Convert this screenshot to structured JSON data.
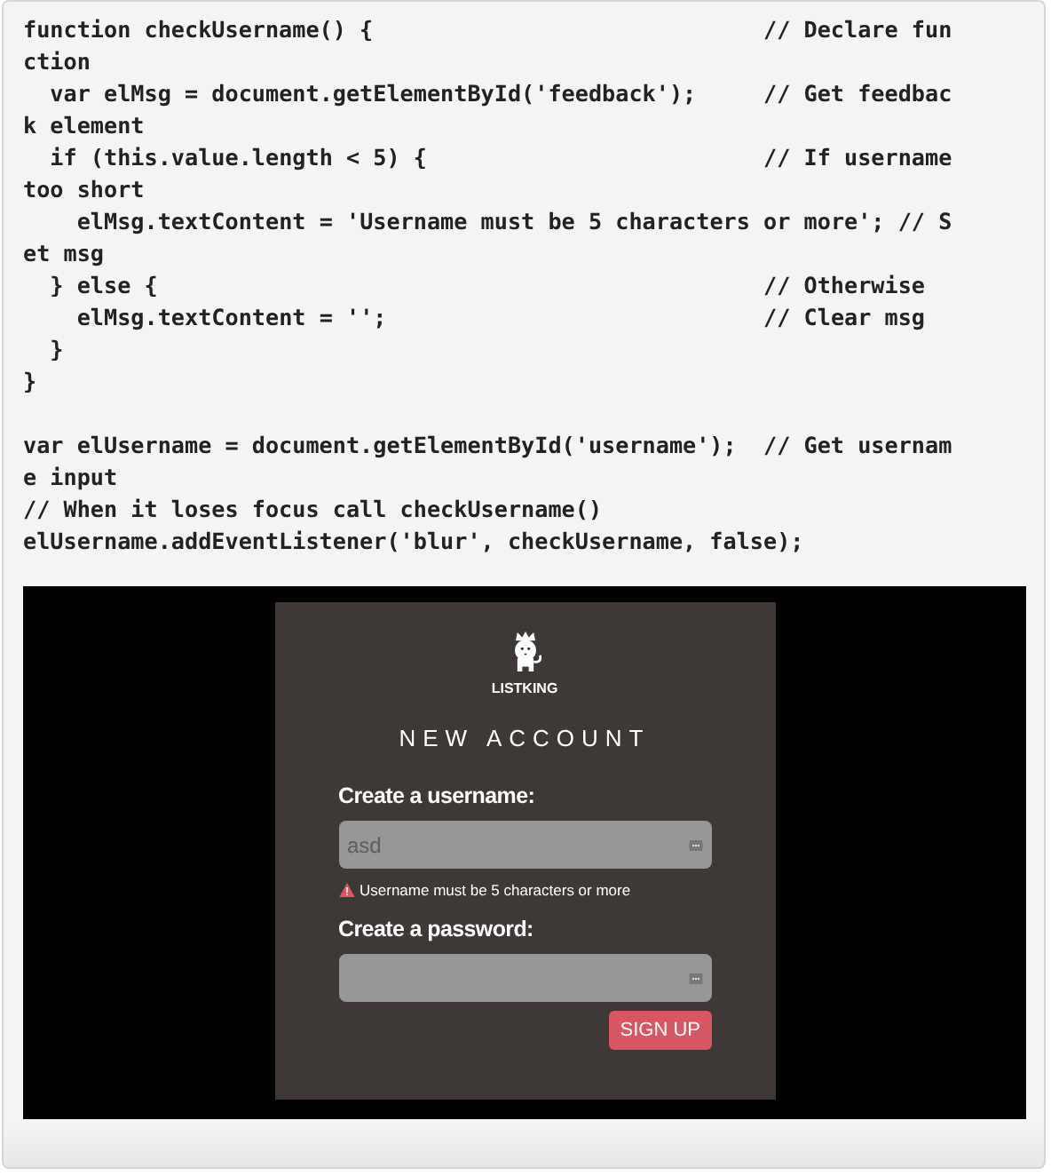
{
  "code_blocks": [
    [
      "function checkUsername() {                             // Declare function",
      "  var elMsg = document.getElementById('feedback');     // Get feedback element",
      "  if (this.value.length < 5) {                         // If username too short",
      "    elMsg.textContent = 'Username must be 5 characters or more'; // Set msg",
      "  } else {                                             // Otherwise",
      "    elMsg.textContent = '';                            // Clear msg",
      "  }",
      "}"
    ],
    [
      "var elUsername = document.getElementById('username');  // Get username input",
      "// When it loses focus call checkUsername()",
      "elUsername.addEventListener('blur', checkUsername, false);"
    ]
  ],
  "demo": {
    "brand": "LISTKING",
    "heading": "NEW ACCOUNT",
    "fields": [
      {
        "label": "Create a username:",
        "value": "asd",
        "error": "Username must be 5 characters or more"
      },
      {
        "label": "Create a password:"
      }
    ],
    "button": "SIGN UP"
  }
}
